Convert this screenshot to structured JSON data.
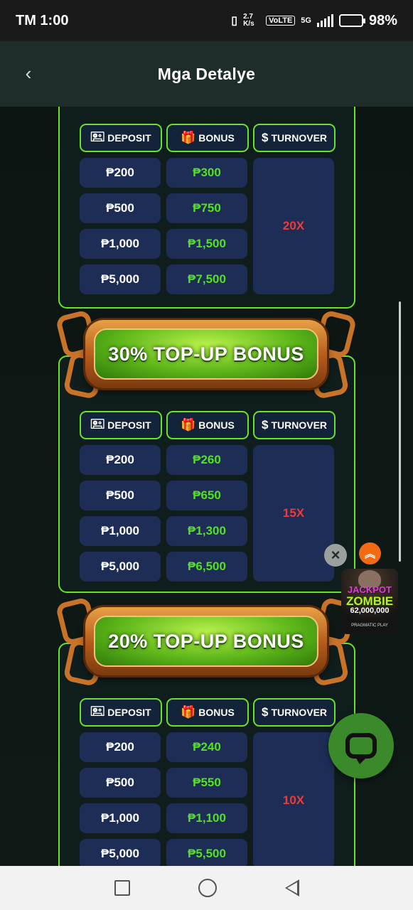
{
  "status_bar": {
    "time": "TM 1:00",
    "net_speed": "2.7 K/s",
    "volte": "VoLTE",
    "network": "5G",
    "battery": "98%",
    "battery_level": 0.98
  },
  "header": {
    "back_icon": "chevron-left-icon",
    "title": "Mga Detalye"
  },
  "table_headers": {
    "deposit": "DEPOSIT",
    "bonus": "BONUS",
    "turnover": "TURNOVER"
  },
  "sections": [
    {
      "title": "",
      "rows": [
        {
          "deposit": "₱200",
          "bonus": "₱300"
        },
        {
          "deposit": "₱500",
          "bonus": "₱750"
        },
        {
          "deposit": "₱1,000",
          "bonus": "₱1,500"
        },
        {
          "deposit": "₱5,000",
          "bonus": "₱7,500"
        }
      ],
      "turnover": "20X"
    },
    {
      "title": "30% TOP-UP BONUS",
      "rows": [
        {
          "deposit": "₱200",
          "bonus": "₱260"
        },
        {
          "deposit": "₱500",
          "bonus": "₱650"
        },
        {
          "deposit": "₱1,000",
          "bonus": "₱1,300"
        },
        {
          "deposit": "₱5,000",
          "bonus": "₱6,500"
        }
      ],
      "turnover": "15X"
    },
    {
      "title": "20% TOP-UP BONUS",
      "rows": [
        {
          "deposit": "₱200",
          "bonus": "₱240"
        },
        {
          "deposit": "₱500",
          "bonus": "₱550"
        },
        {
          "deposit": "₱1,000",
          "bonus": "₱1,100"
        },
        {
          "deposit": "₱5,000",
          "bonus": "₱5,500"
        }
      ],
      "turnover": "10X"
    }
  ],
  "promo": {
    "line1": "JACKPOT",
    "line2": "ZOMBIE",
    "amount": "62,000,000",
    "brand": "PRAGMATIC PLAY"
  },
  "fab": {
    "close_icon": "close-icon",
    "scroll_top_icon": "chevrons-up-icon",
    "chat_icon": "chat-bubble-icon"
  },
  "colors": {
    "accent_green": "#6be12b",
    "bonus_text": "#52e21f",
    "turnover_text": "#ee3a3a",
    "cell_bg": "#1d2d55",
    "header_bg": "#1e2c2a"
  }
}
